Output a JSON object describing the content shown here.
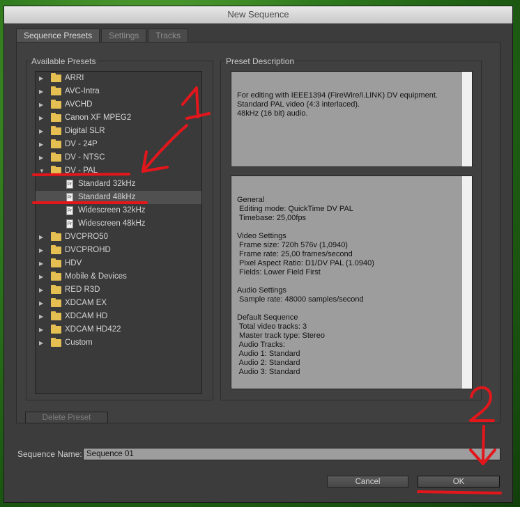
{
  "window": {
    "title": "New Sequence"
  },
  "tabs": [
    {
      "label": "Sequence Presets",
      "active": true
    },
    {
      "label": "Settings",
      "active": false
    },
    {
      "label": "Tracks",
      "active": false
    }
  ],
  "presets": {
    "group_label": "Available Presets",
    "items": [
      {
        "label": "ARRI",
        "type": "folder",
        "expanded": false
      },
      {
        "label": "AVC-Intra",
        "type": "folder",
        "expanded": false
      },
      {
        "label": "AVCHD",
        "type": "folder",
        "expanded": false
      },
      {
        "label": "Canon XF MPEG2",
        "type": "folder",
        "expanded": false
      },
      {
        "label": "Digital SLR",
        "type": "folder",
        "expanded": false
      },
      {
        "label": "DV - 24P",
        "type": "folder",
        "expanded": false
      },
      {
        "label": "DV - NTSC",
        "type": "folder",
        "expanded": false
      },
      {
        "label": "DV - PAL",
        "type": "folder",
        "expanded": true
      },
      {
        "label": "Standard 32kHz",
        "type": "file"
      },
      {
        "label": "Standard 48kHz",
        "type": "file",
        "selected": true
      },
      {
        "label": "Widescreen 32kHz",
        "type": "file"
      },
      {
        "label": "Widescreen 48kHz",
        "type": "file"
      },
      {
        "label": "DVCPRO50",
        "type": "folder",
        "expanded": false
      },
      {
        "label": "DVCPROHD",
        "type": "folder",
        "expanded": false
      },
      {
        "label": "HDV",
        "type": "folder",
        "expanded": false
      },
      {
        "label": "Mobile & Devices",
        "type": "folder",
        "expanded": false
      },
      {
        "label": "RED R3D",
        "type": "folder",
        "expanded": false
      },
      {
        "label": "XDCAM EX",
        "type": "folder",
        "expanded": false
      },
      {
        "label": "XDCAM HD",
        "type": "folder",
        "expanded": false
      },
      {
        "label": "XDCAM HD422",
        "type": "folder",
        "expanded": false
      },
      {
        "label": "Custom",
        "type": "folder",
        "expanded": false
      }
    ],
    "file_icon_text": "Pr"
  },
  "description": {
    "group_label": "Preset Description",
    "summary": "For editing with IEEE1394 (FireWire/i.LINK) DV equipment.\nStandard PAL video (4:3 interlaced).\n48kHz (16 bit) audio.",
    "details": "General\n Editing mode: QuickTime DV PAL\n Timebase: 25,00fps\n\nVideo Settings\n Frame size: 720h 576v (1,0940)\n Frame rate: 25,00 frames/second\n Pixel Aspect Ratio: D1/DV PAL (1.0940)\n Fields: Lower Field First\n\nAudio Settings\n Sample rate: 48000 samples/second\n\nDefault Sequence\n Total video tracks: 3\n Master track type: Stereo\n Audio Tracks:\n Audio 1: Standard\n Audio 2: Standard\n Audio 3: Standard"
  },
  "buttons": {
    "delete_preset": "Delete Preset",
    "cancel": "Cancel",
    "ok": "OK"
  },
  "sequence_name": {
    "label": "Sequence Name:",
    "value": "Sequence 01"
  },
  "annotations": {
    "marker_1": "1",
    "marker_2": "2",
    "color": "#e3161b"
  },
  "colors": {
    "folder": "#e6bf52",
    "dialog_bg": "#3c3c3c",
    "field_bg": "#9d9d9d"
  }
}
